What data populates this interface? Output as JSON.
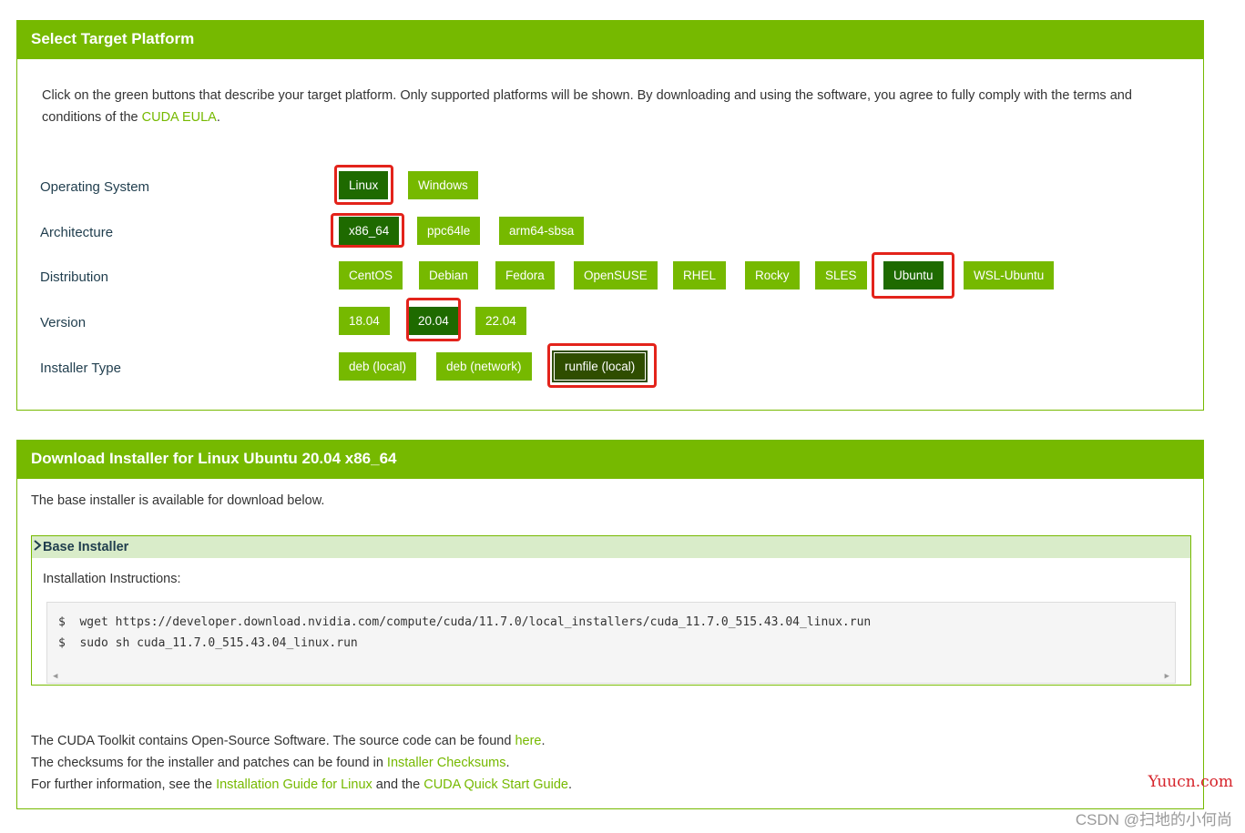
{
  "select_panel": {
    "title": "Select Target Platform",
    "intro_text": "Click on the green buttons that describe your target platform. Only supported platforms will be shown. By downloading and using the software, you agree to fully comply with the terms and conditions of the ",
    "eula_link": "CUDA EULA",
    "intro_end": ".",
    "rows": {
      "os": {
        "label": "Operating System",
        "options": [
          "Linux",
          "Windows"
        ],
        "selected": "Linux"
      },
      "arch": {
        "label": "Architecture",
        "options": [
          "x86_64",
          "ppc64le",
          "arm64-sbsa"
        ],
        "selected": "x86_64"
      },
      "distro": {
        "label": "Distribution",
        "options": [
          "CentOS",
          "Debian",
          "Fedora",
          "OpenSUSE",
          "RHEL",
          "Rocky",
          "SLES",
          "Ubuntu",
          "WSL-Ubuntu"
        ],
        "selected": "Ubuntu"
      },
      "version": {
        "label": "Version",
        "options": [
          "18.04",
          "20.04",
          "22.04"
        ],
        "selected": "20.04"
      },
      "installer": {
        "label": "Installer Type",
        "options": [
          "deb (local)",
          "deb (network)",
          "runfile (local)"
        ],
        "selected": "runfile (local)"
      }
    }
  },
  "download_panel": {
    "title": "Download Installer for Linux Ubuntu 20.04 x86_64",
    "subtitle": "The base installer is available for download below.",
    "base_installer": {
      "heading": "Base Installer",
      "instructions_label": "Installation Instructions:",
      "commands": [
        {
          "prompt": "$",
          "cmd": "wget https://developer.download.nvidia.com/compute/cuda/11.7.0/local_installers/cuda_11.7.0_515.43.04_linux.run"
        },
        {
          "prompt": "$",
          "cmd": "sudo sh cuda_11.7.0_515.43.04_linux.run"
        }
      ]
    },
    "footer": {
      "line1_a": "The CUDA Toolkit contains Open-Source Software. The source code can be found ",
      "line1_link": "here",
      "line1_b": ".",
      "line2_a": "The checksums for the installer and patches can be found in ",
      "line2_link": "Installer Checksums",
      "line2_b": ".",
      "line3_a": "For further information, see the ",
      "line3_link1": "Installation Guide for Linux",
      "line3_mid": " and the ",
      "line3_link2": "CUDA Quick Start Guide",
      "line3_b": "."
    }
  },
  "watermarks": {
    "site": "Yuucn.com",
    "author": "CSDN @扫地的小何尚"
  },
  "colors": {
    "brand_green": "#76b900",
    "selected_green": "#1e6a00",
    "highlight_red": "#e3231b"
  }
}
